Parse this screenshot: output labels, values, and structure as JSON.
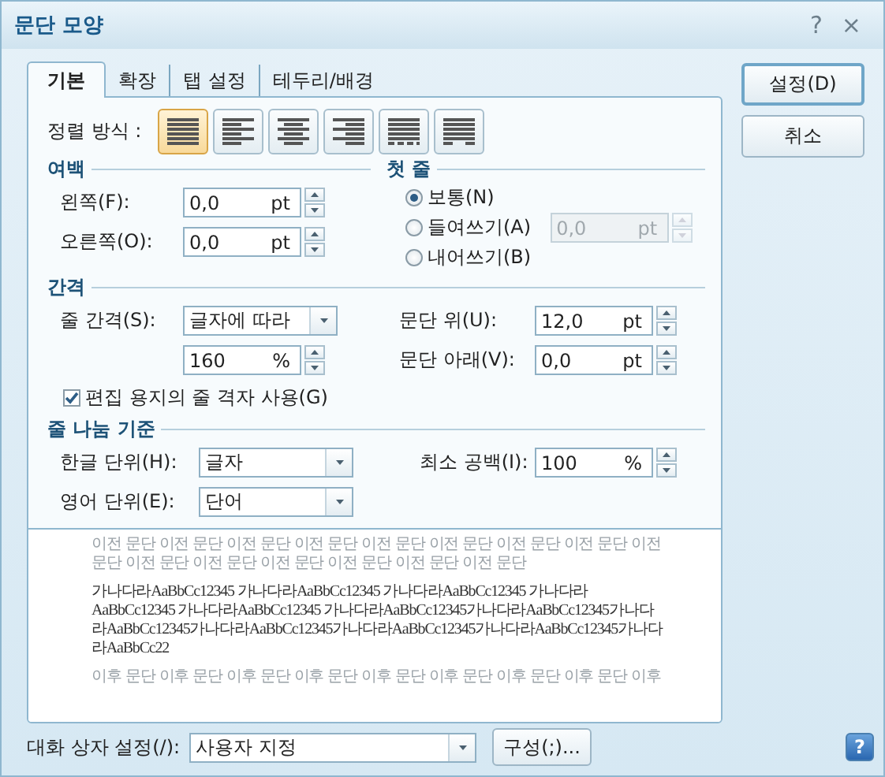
{
  "window": {
    "title": "문단 모양",
    "help_button": "?",
    "close_button": "×"
  },
  "tabs": [
    {
      "label": "기본",
      "selected": true
    },
    {
      "label": "확장",
      "selected": false
    },
    {
      "label": "탭 설정",
      "selected": false
    },
    {
      "label": "테두리/배경",
      "selected": false
    }
  ],
  "alignment": {
    "label": "정렬 방식 :",
    "options": [
      {
        "kind": "justify",
        "selected": true
      },
      {
        "kind": "left",
        "selected": false
      },
      {
        "kind": "center",
        "selected": false
      },
      {
        "kind": "right",
        "selected": false
      },
      {
        "kind": "distribute",
        "selected": false
      },
      {
        "kind": "split",
        "selected": false
      }
    ]
  },
  "margins": {
    "heading": "여백",
    "fields": [
      {
        "label": "왼쪽(F):",
        "value": "0,0",
        "unit": "pt"
      },
      {
        "label": "오른쪽(O):",
        "value": "0,0",
        "unit": "pt"
      }
    ]
  },
  "first_line": {
    "heading": "첫 줄",
    "options": [
      {
        "label": "보통(N)",
        "selected": true
      },
      {
        "label": "들여쓰기(A)",
        "selected": false
      },
      {
        "label": "내어쓰기(B)",
        "selected": false
      }
    ],
    "amount": {
      "value": "0,0",
      "unit": "pt",
      "disabled": true
    }
  },
  "spacing": {
    "heading": "간격",
    "line_spacing": {
      "label": "줄 간격(S):",
      "value": "글자에 따라"
    },
    "line_amount": {
      "value": "160",
      "unit": "%"
    },
    "above": {
      "label": "문단 위(U):",
      "value": "12,0",
      "unit": "pt"
    },
    "below": {
      "label": "문단 아래(V):",
      "value": "0,0",
      "unit": "pt"
    },
    "grid_checkbox": {
      "label": "편집 용지의 줄 격자 사용(G)",
      "checked": true
    }
  },
  "line_break": {
    "heading": "줄 나눔 기준",
    "korean": {
      "label": "한글 단위(H):",
      "value": "글자"
    },
    "min_space": {
      "label": "최소 공백(I):",
      "value": "100",
      "unit": "%"
    },
    "english": {
      "label": "영어 단위(E):",
      "value": "단어"
    }
  },
  "preview": {
    "paragraphs": [
      {
        "kind": "previous",
        "lines": [
          "이전 문단 이전 문단 이전 문단 이전 문단 이전 문단 이전 문단 이전 문단 이전 문단 이전",
          "문단 이전 문단 이전 문단 이전 문단 이전 문단 이전 문단 이전 문단"
        ]
      },
      {
        "kind": "current",
        "lines": [
          "가나다라AaBbCc12345 가나다라AaBbCc12345 가나다라AaBbCc12345 가나다라",
          "AaBbCc12345 가나다라AaBbCc12345 가나다라AaBbCc12345가나다라AaBbCc12345가나다",
          "라AaBbCc12345가나다라AaBbCc12345가나다라AaBbCc12345가나다라AaBbCc12345가나다",
          "라AaBbCc22"
        ]
      },
      {
        "kind": "next",
        "lines": [
          "이후 문단 이후 문단 이후 문단 이후 문단 이후 문단 이후 문단 이후 문단 이후 문단 이후"
        ]
      }
    ]
  },
  "footer": {
    "label": "대화 상자 설정(/):",
    "preset": "사용자 지정",
    "configure_button": "구성(;)...",
    "help_button": "?"
  },
  "buttons": [
    {
      "label": "설정(D)",
      "default": true
    },
    {
      "label": "취소",
      "default": false
    }
  ]
}
